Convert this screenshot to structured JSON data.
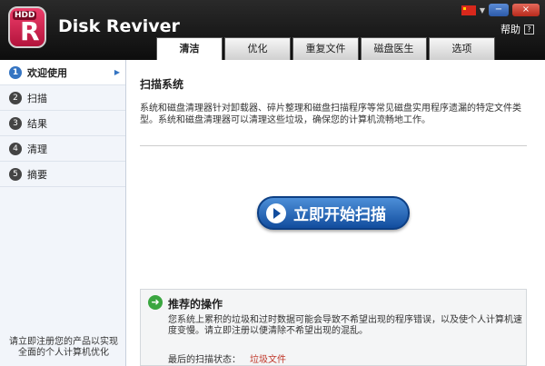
{
  "app": {
    "logo_badge": "HDD",
    "logo_letter": "R",
    "title": "Disk Reviver"
  },
  "window": {
    "help_label": "帮助",
    "help_icon": "?",
    "minimize": "−",
    "close": "×"
  },
  "tabs": [
    {
      "label": "清洁",
      "active": true
    },
    {
      "label": "优化"
    },
    {
      "label": "重复文件"
    },
    {
      "label": "磁盘医生"
    },
    {
      "label": "选项"
    }
  ],
  "sidebar": {
    "items": [
      {
        "num": "1",
        "label": "欢迎使用",
        "active": true
      },
      {
        "num": "2",
        "label": "扫描"
      },
      {
        "num": "3",
        "label": "结果"
      },
      {
        "num": "4",
        "label": "清理"
      },
      {
        "num": "5",
        "label": "摘要"
      }
    ],
    "footer": "请立即注册您的产品以实现全面的个人计算机优化"
  },
  "main": {
    "title": "扫描系统",
    "description": "系统和磁盘清理器针对卸载器、碎片整理和磁盘扫描程序等常见磁盘实用程序遗漏的特定文件类型。系统和磁盘清理器可以清理这些垃圾，确保您的计算机流畅地工作。",
    "scan_button": "立即开始扫描",
    "recommended": {
      "title": "推荐的操作",
      "text": "您系统上累积的垃圾和过时数据可能会导致不希望出现的程序错误，以及使个人计算机速度变慢。请立即注册以便清除不希望出现的混乱。",
      "last_scan_label": "最后的扫描状态：",
      "last_scan_value": "垃圾文件"
    }
  }
}
